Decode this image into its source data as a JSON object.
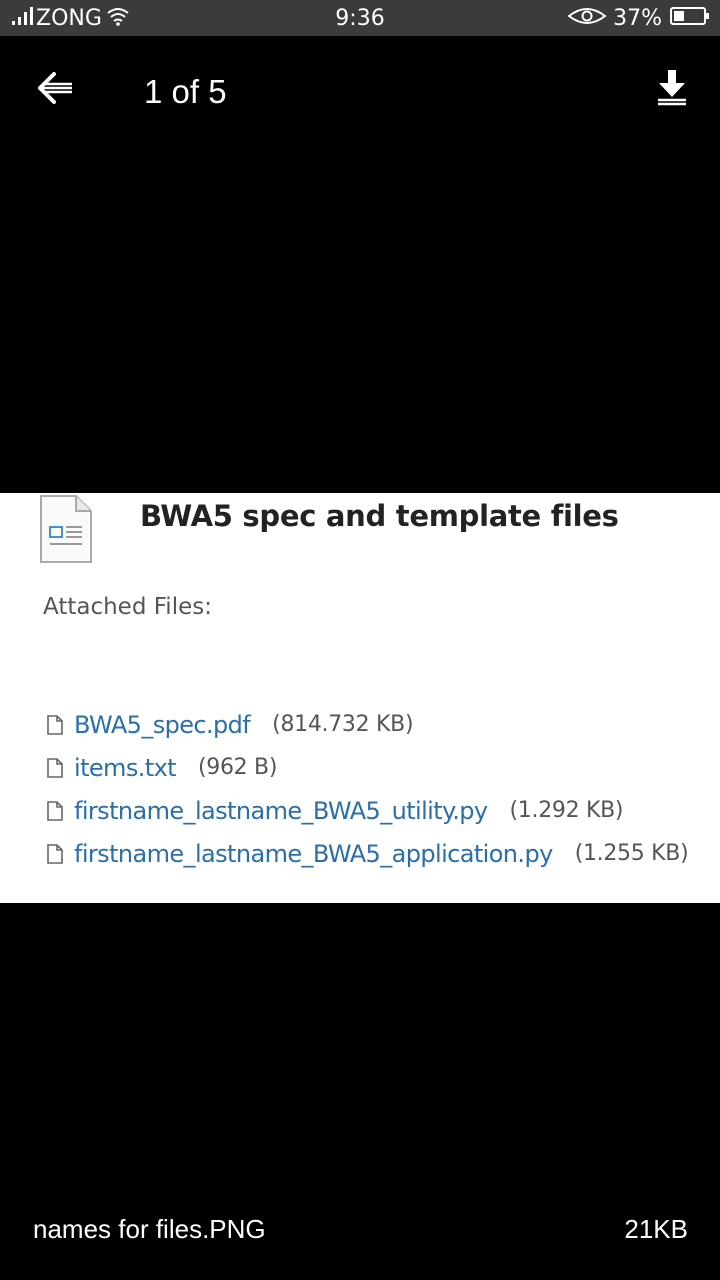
{
  "status_bar": {
    "carrier": "ZONG",
    "time": "9:36",
    "battery_percent": "37%",
    "battery_level": 0.37,
    "icons": [
      "signal-icon",
      "wifi-icon",
      "eye-icon",
      "battery-icon"
    ]
  },
  "viewer": {
    "counter": "1 of 5",
    "back_icon": "back-arrow-icon",
    "download_icon": "download-icon"
  },
  "image_content": {
    "title": "BWA5 spec and template files",
    "attached_label": "Attached Files:",
    "files": [
      {
        "name": "BWA5_spec.pdf",
        "size": "(814.732 KB)"
      },
      {
        "name": "items.txt",
        "size": "(962 B)"
      },
      {
        "name": "firstname_lastname_BWA5_utility.py",
        "size": "(1.292 KB)"
      },
      {
        "name": "firstname_lastname_BWA5_application.py",
        "size": "(1.255 KB)"
      }
    ]
  },
  "footer": {
    "file_name": "names for files.PNG",
    "file_size": "21KB"
  },
  "colors": {
    "background": "#000000",
    "status_bar": "#3b3b3b",
    "link": "#2a6fa8"
  }
}
